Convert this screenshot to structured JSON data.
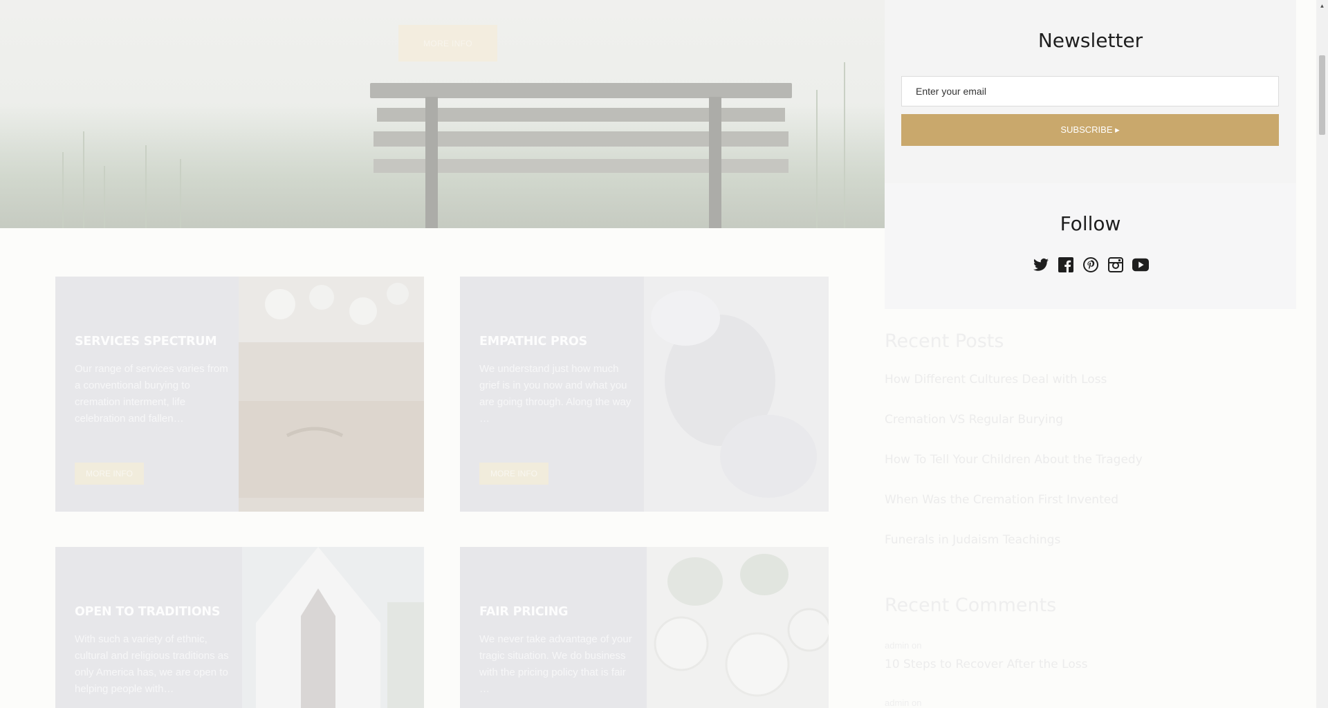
{
  "hero": {
    "button_label": "MORE INFO"
  },
  "cards": [
    {
      "title": "SERVICES SPECTRUM",
      "text": "Our range of services varies from a conventional burying to cremation interment, life celebration and fallen…",
      "button": "MORE INFO"
    },
    {
      "title": "EMPATHIC PROS",
      "text": "We understand just how much grief is in you now and what you are going through. Along the way …",
      "button": "MORE INFO"
    },
    {
      "title": "OPEN TO TRADITIONS",
      "text": "With such a variety of ethnic, cultural and religious traditions as only America has, we are open to helping people with…"
    },
    {
      "title": "FAIR PRICING",
      "text": "We never take advantage of your tragic situation. We do business with the pricing policy that is fair …"
    }
  ],
  "sidebar": {
    "newsletter": {
      "title": "Newsletter",
      "placeholder": "Enter your email",
      "subscribe_label": "SUBSCRIBE ▸"
    },
    "follow": {
      "title": "Follow",
      "icons": [
        "twitter-icon",
        "facebook-icon",
        "pinterest-icon",
        "instagram-icon",
        "youtube-icon"
      ]
    },
    "recent_posts": {
      "title": "Recent Posts",
      "items": [
        "How Different Cultures Deal with Loss",
        "Cremation VS Regular Burying",
        "How To Tell Your Children About the Tragedy",
        "When Was the Cremation First Invented",
        "Funerals in Judaism Teachings"
      ]
    },
    "recent_comments": {
      "title": "Recent Comments",
      "items": [
        {
          "author": "admin",
          "on": "on",
          "post": "10 Steps to Recover After the Loss"
        },
        {
          "author": "admin",
          "on": "on",
          "post": ""
        }
      ]
    }
  },
  "colors": {
    "accent": "#c9a86c",
    "title_text": "#1e1e1e"
  }
}
